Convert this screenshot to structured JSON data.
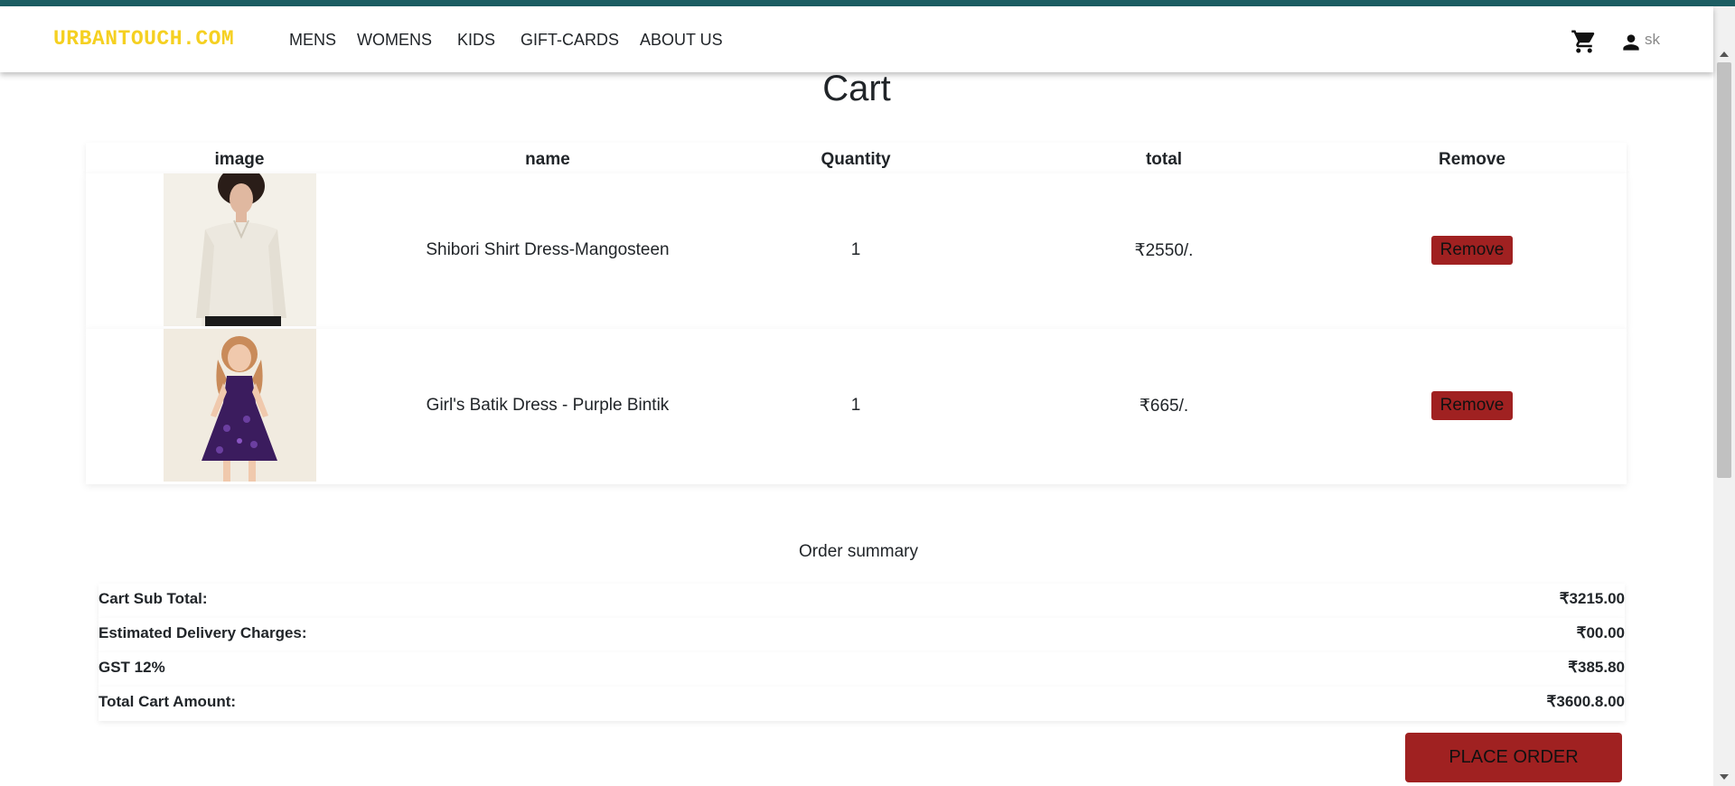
{
  "brand": "URBANTOUCH.COM",
  "nav": {
    "mens": "MENS",
    "womens": "WOMENS",
    "kids": "KIDS",
    "gift_cards": "GIFT-CARDS",
    "about": "ABOUT US"
  },
  "user": {
    "name": "sk"
  },
  "icons": {
    "cart": "cart-icon",
    "user": "person-icon"
  },
  "page_title": "Cart",
  "table": {
    "headers": [
      "image",
      "name",
      "Quantity",
      "total",
      "Remove"
    ],
    "rows": [
      {
        "name": "Shibori Shirt Dress-Mangosteen",
        "quantity": "1",
        "total": "₹2550/.",
        "remove": "Remove"
      },
      {
        "name": "Girl's Batik Dress - Purple Bintik",
        "quantity": "1",
        "total": "₹665/.",
        "remove": "Remove"
      }
    ]
  },
  "summary": {
    "title": "Order summary",
    "rows": [
      {
        "label": "Cart Sub Total:",
        "value": "₹3215.00"
      },
      {
        "label": "Estimated Delivery Charges:",
        "value": "₹00.00"
      },
      {
        "label": "GST 12%",
        "value": "₹385.80"
      },
      {
        "label": "Total Cart Amount:",
        "value": "₹3600.8.00"
      }
    ]
  },
  "place_order": "PLACE ORDER",
  "colors": {
    "accent": "#a02121",
    "brand": "#f5d021",
    "topbar": "#1c5e63"
  }
}
